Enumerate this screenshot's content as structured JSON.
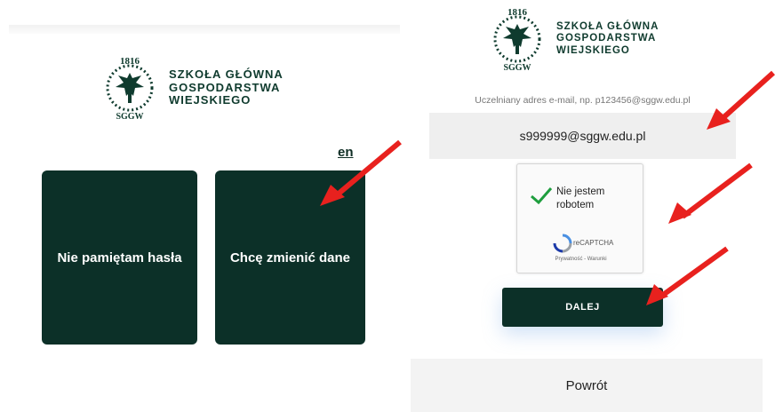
{
  "logo": {
    "year": "1816",
    "abbr": "SGGW",
    "line1": "SZKOŁA GŁÓWNA",
    "line2": "GOSPODARSTWA",
    "line3": "WIEJSKIEGO"
  },
  "left": {
    "lang_link": "en",
    "tile_forgot": "Nie pamiętam hasła",
    "tile_change": "Chcę zmienić dane"
  },
  "right": {
    "email_label": "Uczelniany adres e-mail, np. p123456@sggw.edu.pl",
    "email_value": "s999999@sggw.edu.pl",
    "captcha_label": "Nie jestem robotem",
    "captcha_brand": "reCAPTCHA",
    "captcha_links": "Prywatność - Warunki",
    "next_button": "DALEJ",
    "back_button": "Powrót"
  },
  "colors": {
    "brand_green": "#0c3028",
    "arrow_red": "#e8211e"
  },
  "icons": {
    "captcha_check": "green-checkmark-icon",
    "captcha_logo": "recaptcha-logo-icon",
    "emblem": "sggw-eagle-emblem"
  }
}
